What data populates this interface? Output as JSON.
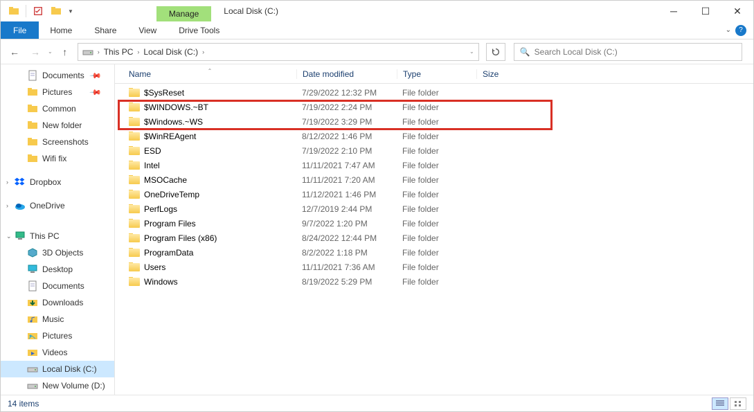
{
  "window": {
    "title": "Local Disk (C:)",
    "ribbon_context": "Manage",
    "ribbon_context_sub": "Drive Tools"
  },
  "ribbon_tabs": {
    "file": "File",
    "home": "Home",
    "share": "Share",
    "view": "View",
    "drive_tools": "Drive Tools"
  },
  "breadcrumb": {
    "seg1": "This PC",
    "seg2": "Local Disk (C:)"
  },
  "search": {
    "placeholder": "Search Local Disk (C:)"
  },
  "sidebar": {
    "quick": [
      {
        "label": "Documents",
        "icon": "doc",
        "pinned": true
      },
      {
        "label": "Pictures",
        "icon": "folder",
        "pinned": true
      },
      {
        "label": "Common",
        "icon": "folder"
      },
      {
        "label": "New folder",
        "icon": "folder"
      },
      {
        "label": "Screenshots",
        "icon": "folder"
      },
      {
        "label": "Wifi fix",
        "icon": "folder"
      }
    ],
    "cloud": [
      {
        "label": "Dropbox",
        "icon": "dropbox"
      },
      {
        "label": "OneDrive",
        "icon": "onedrive"
      }
    ],
    "thispc_label": "This PC",
    "thispc": [
      {
        "label": "3D Objects",
        "icon": "3d"
      },
      {
        "label": "Desktop",
        "icon": "desktop"
      },
      {
        "label": "Documents",
        "icon": "doc"
      },
      {
        "label": "Downloads",
        "icon": "downloads"
      },
      {
        "label": "Music",
        "icon": "music"
      },
      {
        "label": "Pictures",
        "icon": "pictures"
      },
      {
        "label": "Videos",
        "icon": "videos"
      },
      {
        "label": "Local Disk (C:)",
        "icon": "drive",
        "selected": true
      },
      {
        "label": "New Volume (D:)",
        "icon": "drive"
      }
    ]
  },
  "columns": {
    "name": "Name",
    "date": "Date modified",
    "type": "Type",
    "size": "Size"
  },
  "files": [
    {
      "name": "$SysReset",
      "date": "7/29/2022 12:32 PM",
      "type": "File folder"
    },
    {
      "name": "$WINDOWS.~BT",
      "date": "7/19/2022 2:24 PM",
      "type": "File folder"
    },
    {
      "name": "$Windows.~WS",
      "date": "7/19/2022 3:29 PM",
      "type": "File folder"
    },
    {
      "name": "$WinREAgent",
      "date": "8/12/2022 1:46 PM",
      "type": "File folder"
    },
    {
      "name": "ESD",
      "date": "7/19/2022 2:10 PM",
      "type": "File folder"
    },
    {
      "name": "Intel",
      "date": "11/11/2021 7:47 AM",
      "type": "File folder"
    },
    {
      "name": "MSOCache",
      "date": "11/11/2021 7:20 AM",
      "type": "File folder"
    },
    {
      "name": "OneDriveTemp",
      "date": "11/12/2021 1:46 PM",
      "type": "File folder"
    },
    {
      "name": "PerfLogs",
      "date": "12/7/2019 2:44 PM",
      "type": "File folder"
    },
    {
      "name": "Program Files",
      "date": "9/7/2022 1:20 PM",
      "type": "File folder"
    },
    {
      "name": "Program Files (x86)",
      "date": "8/24/2022 12:44 PM",
      "type": "File folder"
    },
    {
      "name": "ProgramData",
      "date": "8/2/2022 1:18 PM",
      "type": "File folder"
    },
    {
      "name": "Users",
      "date": "11/11/2021 7:36 AM",
      "type": "File folder"
    },
    {
      "name": "Windows",
      "date": "8/19/2022 5:29 PM",
      "type": "File folder"
    }
  ],
  "status": {
    "count": "14 items"
  }
}
